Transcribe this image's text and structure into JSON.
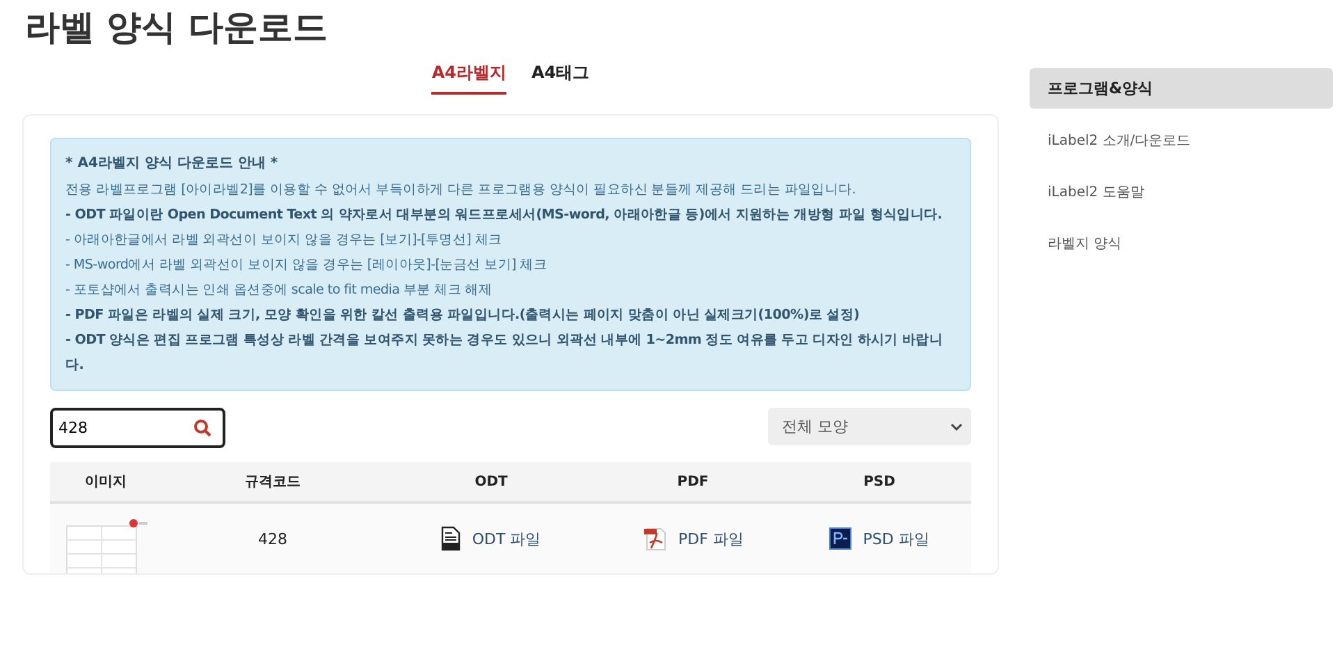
{
  "page_title": "라벨 양식 다운로드",
  "tabs": [
    {
      "label": "A4라벨지",
      "selected": true
    },
    {
      "label": "A4태그",
      "selected": false
    }
  ],
  "notice": {
    "heading": "* A4라벨지 양식 다운로드 안내 *",
    "lines": [
      {
        "text": "전용 라벨프로그램 [아이라벨2]를 이용할 수 없어서 부득이하게 다른 프로그램용 양식이 필요하신 분들께 제공해 드리는 파일입니다.",
        "bold": false
      },
      {
        "text": "- ODT 파일이란 Open Document Text 의 약자로서 대부분의 워드프로세서(MS-word, 아래아한글 등)에서 지원하는 개방형 파일 형식입니다.",
        "bold": true
      },
      {
        "text": "- 아래아한글에서 라벨 외곽선이 보이지 않을 경우는 [보기]-[투명선] 체크",
        "bold": false
      },
      {
        "text": "- MS-word에서 라벨 외곽선이 보이지 않을 경우는 [레이아웃]-[눈금선 보기] 체크",
        "bold": false
      },
      {
        "text": "- 포토샵에서 출력시는 인쇄 옵션중에 scale to fit media 부분 체크 해제",
        "bold": false
      },
      {
        "text": "- PDF 파일은 라벨의 실제 크기, 모양 확인을 위한 칼선 출력용 파일입니다.(출력시는 페이지 맞춤이 아닌 실제크기(100%)로 설정)",
        "bold": true
      },
      {
        "text": "- ODT 양식은 편집 프로그램 특성상 라벨 간격을 보여주지 못하는 경우도 있으니 외곽선 내부에 1~2mm 정도 여유를 두고 디자인 하시기 바랍니다.",
        "bold": true
      }
    ]
  },
  "search": {
    "value": "428"
  },
  "shape_select": {
    "value": "전체 모양"
  },
  "table": {
    "columns": [
      "이미지",
      "규격코드",
      "ODT",
      "PDF",
      "PSD"
    ],
    "rows": [
      {
        "image": {
          "kind": "picture"
        },
        "code": "428",
        "files": [
          {
            "kind": "odt",
            "label": "ODT 파일"
          },
          {
            "kind": "pdf",
            "label": "PDF 파일"
          },
          {
            "kind": "psd",
            "label": "PSD 파일"
          }
        ]
      }
    ]
  },
  "sidebar": {
    "items": [
      {
        "label": "프로그램&양식",
        "selected": true
      },
      {
        "label": "iLabel2 소개/다운로드",
        "selected": false
      },
      {
        "label": "iLabel2 도움말",
        "selected": false
      },
      {
        "label": "라벨지 양식",
        "selected": false
      }
    ]
  }
}
